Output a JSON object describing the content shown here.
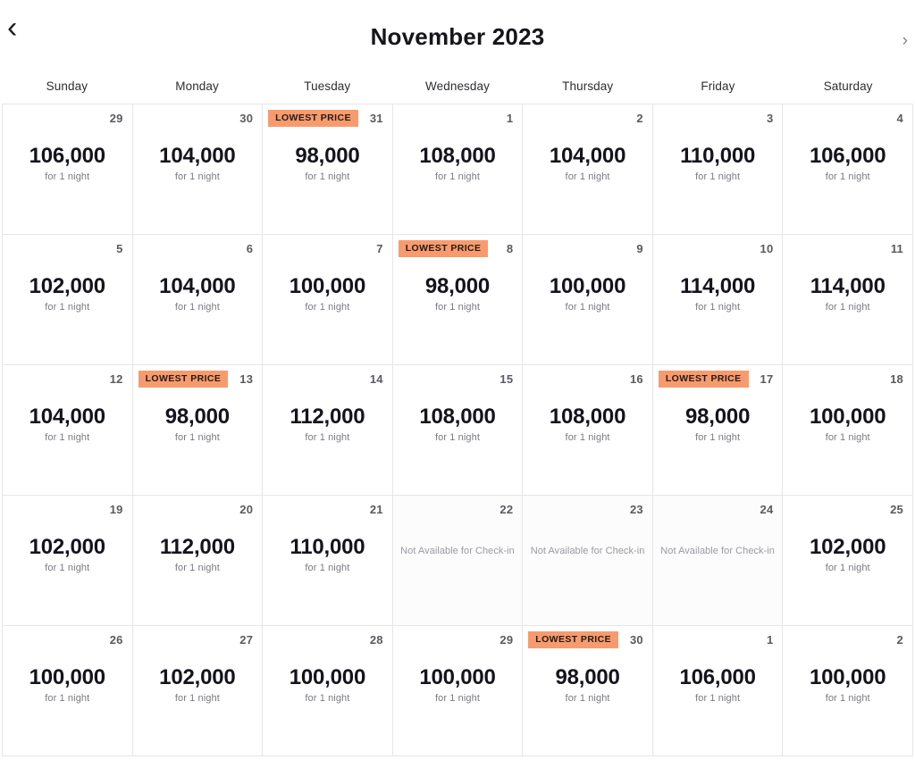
{
  "header": {
    "title": "November 2023",
    "prev_label": "‹",
    "next_label": "›",
    "prev_name": "chevron-left-icon",
    "next_name": "chevron-right-icon"
  },
  "weekdays": [
    "Sunday",
    "Monday",
    "Tuesday",
    "Wednesday",
    "Thursday",
    "Friday",
    "Saturday"
  ],
  "labels": {
    "lowest_price_badge": "LOWEST PRICE",
    "price_unit": "for 1 night",
    "not_available": "Not Available for Check-in"
  },
  "colors": {
    "badge_background": "#f79b6e",
    "badge_text": "#241a12",
    "price_text": "#14141c",
    "muted_text": "#7a7a82",
    "grid_border": "#e6e6e8"
  },
  "weeks": [
    [
      {
        "day": "29",
        "price": "106,000",
        "unit": "for 1 night",
        "lowest": false,
        "available": true
      },
      {
        "day": "30",
        "price": "104,000",
        "unit": "for 1 night",
        "lowest": false,
        "available": true
      },
      {
        "day": "31",
        "price": "98,000",
        "unit": "for 1 night",
        "lowest": true,
        "available": true
      },
      {
        "day": "1",
        "price": "108,000",
        "unit": "for 1 night",
        "lowest": false,
        "available": true
      },
      {
        "day": "2",
        "price": "104,000",
        "unit": "for 1 night",
        "lowest": false,
        "available": true
      },
      {
        "day": "3",
        "price": "110,000",
        "unit": "for 1 night",
        "lowest": false,
        "available": true
      },
      {
        "day": "4",
        "price": "106,000",
        "unit": "for 1 night",
        "lowest": false,
        "available": true
      }
    ],
    [
      {
        "day": "5",
        "price": "102,000",
        "unit": "for 1 night",
        "lowest": false,
        "available": true
      },
      {
        "day": "6",
        "price": "104,000",
        "unit": "for 1 night",
        "lowest": false,
        "available": true
      },
      {
        "day": "7",
        "price": "100,000",
        "unit": "for 1 night",
        "lowest": false,
        "available": true
      },
      {
        "day": "8",
        "price": "98,000",
        "unit": "for 1 night",
        "lowest": true,
        "available": true
      },
      {
        "day": "9",
        "price": "100,000",
        "unit": "for 1 night",
        "lowest": false,
        "available": true
      },
      {
        "day": "10",
        "price": "114,000",
        "unit": "for 1 night",
        "lowest": false,
        "available": true
      },
      {
        "day": "11",
        "price": "114,000",
        "unit": "for 1 night",
        "lowest": false,
        "available": true
      }
    ],
    [
      {
        "day": "12",
        "price": "104,000",
        "unit": "for 1 night",
        "lowest": false,
        "available": true
      },
      {
        "day": "13",
        "price": "98,000",
        "unit": "for 1 night",
        "lowest": true,
        "available": true
      },
      {
        "day": "14",
        "price": "112,000",
        "unit": "for 1 night",
        "lowest": false,
        "available": true
      },
      {
        "day": "15",
        "price": "108,000",
        "unit": "for 1 night",
        "lowest": false,
        "available": true
      },
      {
        "day": "16",
        "price": "108,000",
        "unit": "for 1 night",
        "lowest": false,
        "available": true
      },
      {
        "day": "17",
        "price": "98,000",
        "unit": "for 1 night",
        "lowest": true,
        "available": true
      },
      {
        "day": "18",
        "price": "100,000",
        "unit": "for 1 night",
        "lowest": false,
        "available": true
      }
    ],
    [
      {
        "day": "19",
        "price": "102,000",
        "unit": "for 1 night",
        "lowest": false,
        "available": true
      },
      {
        "day": "20",
        "price": "112,000",
        "unit": "for 1 night",
        "lowest": false,
        "available": true
      },
      {
        "day": "21",
        "price": "110,000",
        "unit": "for 1 night",
        "lowest": false,
        "available": true
      },
      {
        "day": "22",
        "price": "",
        "unit": "",
        "lowest": false,
        "available": false,
        "note": "Not Available for Check-in"
      },
      {
        "day": "23",
        "price": "",
        "unit": "",
        "lowest": false,
        "available": false,
        "note": "Not Available for Check-in"
      },
      {
        "day": "24",
        "price": "",
        "unit": "",
        "lowest": false,
        "available": false,
        "note": "Not Available for Check-in"
      },
      {
        "day": "25",
        "price": "102,000",
        "unit": "for 1 night",
        "lowest": false,
        "available": true
      }
    ],
    [
      {
        "day": "26",
        "price": "100,000",
        "unit": "for 1 night",
        "lowest": false,
        "available": true
      },
      {
        "day": "27",
        "price": "102,000",
        "unit": "for 1 night",
        "lowest": false,
        "available": true
      },
      {
        "day": "28",
        "price": "100,000",
        "unit": "for 1 night",
        "lowest": false,
        "available": true
      },
      {
        "day": "29",
        "price": "100,000",
        "unit": "for 1 night",
        "lowest": false,
        "available": true
      },
      {
        "day": "30",
        "price": "98,000",
        "unit": "for 1 night",
        "lowest": true,
        "available": true
      },
      {
        "day": "1",
        "price": "106,000",
        "unit": "for 1 night",
        "lowest": false,
        "available": true
      },
      {
        "day": "2",
        "price": "100,000",
        "unit": "for 1 night",
        "lowest": false,
        "available": true
      }
    ]
  ]
}
